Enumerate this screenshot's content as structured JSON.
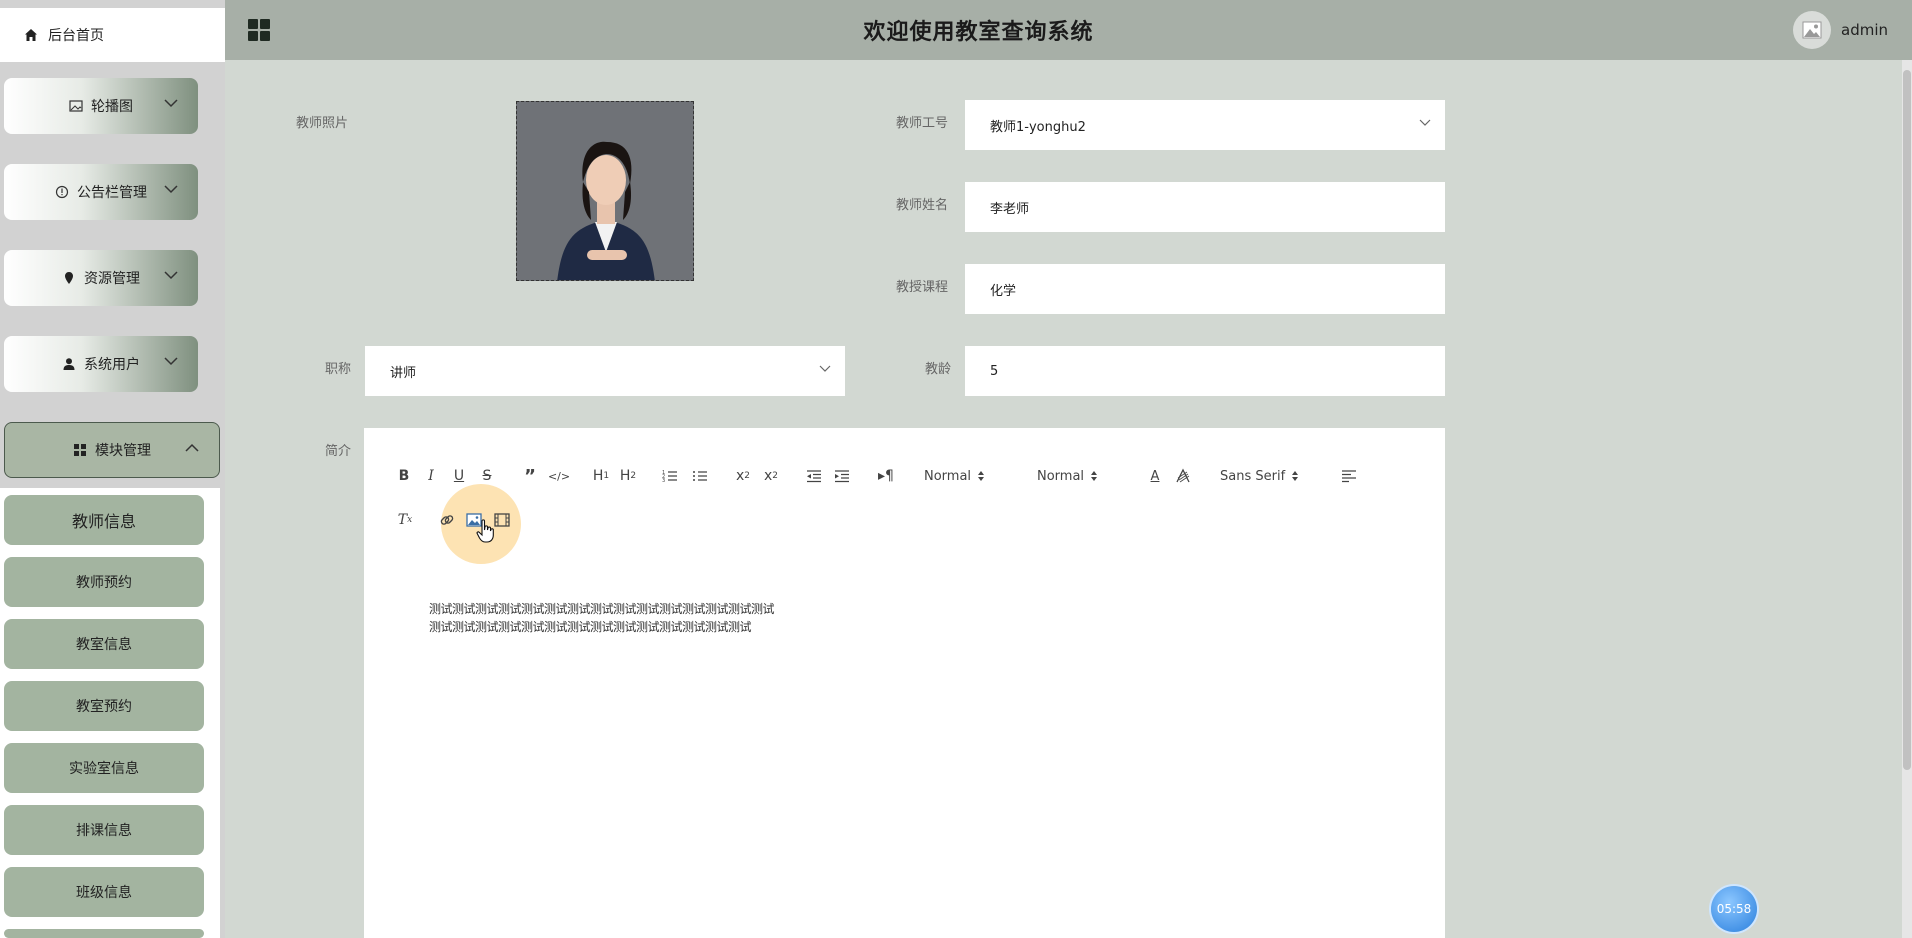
{
  "header": {
    "title": "欢迎使用教室查询系统",
    "username": "admin"
  },
  "sidebar": {
    "home": "后台首页",
    "groups": [
      {
        "label": "轮播图"
      },
      {
        "label": "公告栏管理"
      },
      {
        "label": "资源管理"
      },
      {
        "label": "系统用户"
      },
      {
        "label": "模块管理"
      }
    ],
    "subitems": [
      "教师信息",
      "教师预约",
      "教室信息",
      "教室预约",
      "实验室信息",
      "排课信息",
      "班级信息"
    ]
  },
  "form": {
    "photo_label": "教师照片",
    "id_label": "教师工号",
    "id_value": "教师1-yonghu2",
    "name_label": "教师姓名",
    "name_value": "李老师",
    "course_label": "教授课程",
    "course_value": "化学",
    "title_label": "职称",
    "title_value": "讲师",
    "age_label": "教龄",
    "age_value": "5",
    "intro_label": "简介"
  },
  "editor": {
    "header_select": "Normal",
    "size_select": "Normal",
    "font_select": "Sans Serif",
    "content_line1": "测试测试测试测试测试测试测试测试测试测试测试测试测试测试测试",
    "content_line2": "测试测试测试测试测试测试测试测试测试测试测试测试测试测试"
  },
  "timer": "05:58",
  "colors": {
    "header_bg": "#a7afa7",
    "page_bg": "#d2d8d2",
    "menu_accent": "#7f907f",
    "sub_item": "#a3b4a0"
  }
}
